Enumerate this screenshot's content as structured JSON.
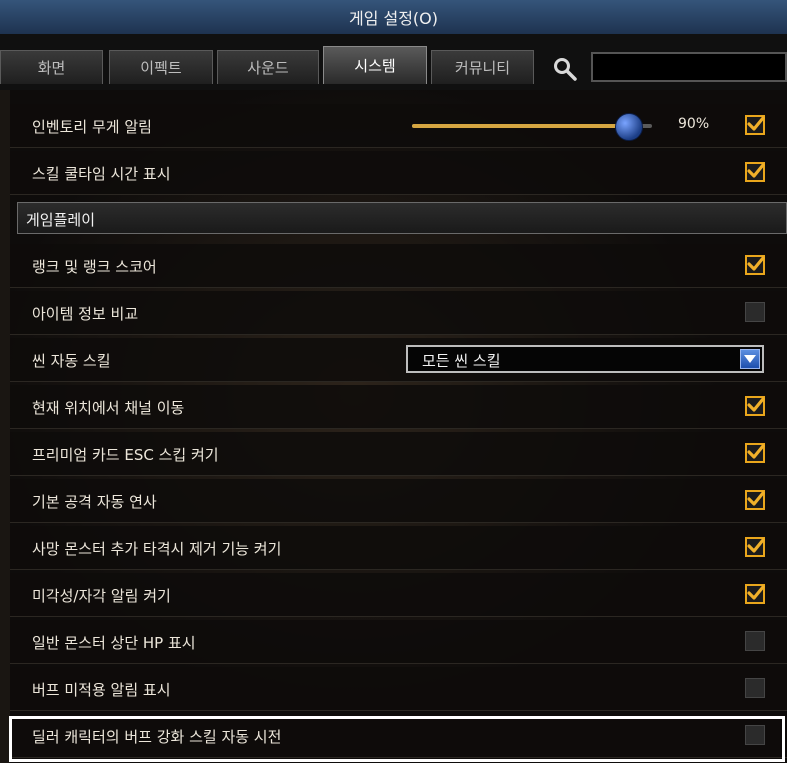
{
  "window": {
    "title": "게임 설정(O)"
  },
  "tabs": [
    {
      "label": "화면",
      "active": false
    },
    {
      "label": "이펙트",
      "active": false
    },
    {
      "label": "사운드",
      "active": false
    },
    {
      "label": "시스템",
      "active": true
    },
    {
      "label": "커뮤니티",
      "active": false
    }
  ],
  "search": {
    "icon": "search-icon",
    "value": ""
  },
  "settings": {
    "inventory_weight": {
      "label": "인벤토리 무게 알림",
      "slider_value": 0.9,
      "value_text": "90%",
      "checked": true
    },
    "skill_cooldown": {
      "label": "스킬 쿨타임 시간 표시",
      "checked": true
    },
    "section_gameplay": {
      "label": "게임플레이"
    },
    "rank_score": {
      "label": "랭크 및 랭크 스코어",
      "checked": true
    },
    "item_compare": {
      "label": "아이템 정보 비교",
      "checked": false
    },
    "scene_auto_skill": {
      "label": "씬 자동 스킬",
      "dropdown_value": "모든 씬 스킬"
    },
    "channel_move": {
      "label": "현재 위치에서 채널 이동",
      "checked": true
    },
    "premium_card_esc": {
      "label": "프리미엄 카드 ESC 스킵 켜기",
      "checked": true
    },
    "auto_attack": {
      "label": "기본 공격 자동 연사",
      "checked": true
    },
    "dead_monster": {
      "label": "사망 몬스터 추가 타격시 제거 기능 켜기",
      "checked": true
    },
    "sense_alert": {
      "label": "미각성/자각 알림 켜기",
      "checked": true
    },
    "monster_hp": {
      "label": "일반 몬스터 상단 HP 표시",
      "checked": false
    },
    "buff_alert": {
      "label": "버프 미적용 알림 표시",
      "checked": false
    },
    "dealer_buff": {
      "label": "딜러 캐릭터의 버프 강화 스킬 자동 시전",
      "checked": false
    }
  },
  "colors": {
    "accent": "#e9a61c",
    "title_bar": "#2a4668",
    "slider_fill": "#d5a641",
    "thumb": "#2f5fc0"
  }
}
